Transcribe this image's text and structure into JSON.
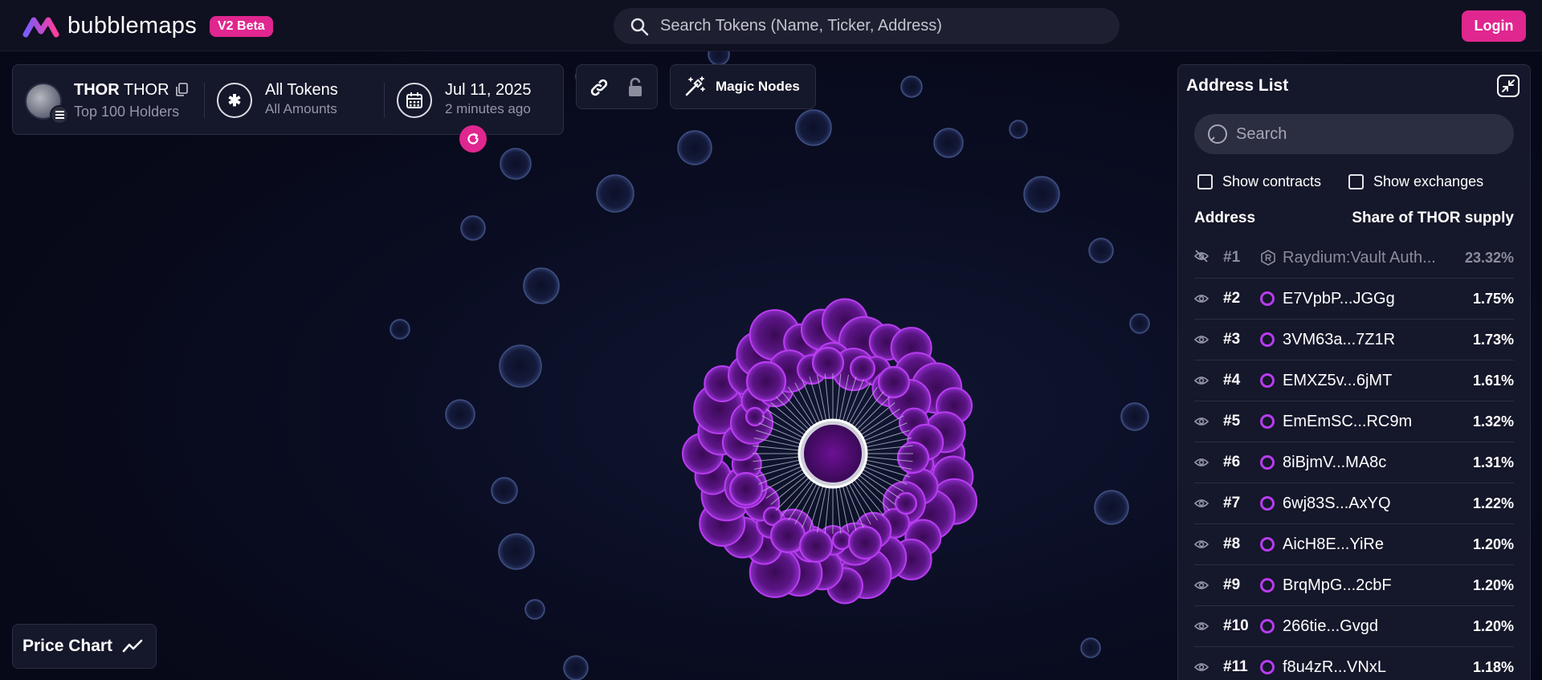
{
  "header": {
    "brand": "bubblemaps",
    "badge": "V2 Beta",
    "search_placeholder": "Search Tokens (Name, Ticker, Address)",
    "login": "Login"
  },
  "token": {
    "name": "THOR",
    "ticker": "THOR",
    "subtitle": "Top 100 Holders",
    "filter_title": "All Tokens",
    "filter_sub": "All Amounts",
    "date": "Jul 11, 2025",
    "date_ago": "2 minutes ago"
  },
  "toolbar": {
    "magic_nodes": "Magic Nodes",
    "price_chart": "Price Chart"
  },
  "address_list": {
    "title": "Address List",
    "search_placeholder": "Search",
    "show_contracts": "Show contracts",
    "show_exchanges": "Show exchanges",
    "col_address": "Address",
    "col_share": "Share of THOR supply",
    "rows": [
      {
        "rank": "#1",
        "address": "Raydium:Vault Auth...",
        "share": "23.32%",
        "hidden": true
      },
      {
        "rank": "#2",
        "address": "E7VpbP...JGGg",
        "share": "1.75%"
      },
      {
        "rank": "#3",
        "address": "3VM63a...7Z1R",
        "share": "1.73%"
      },
      {
        "rank": "#4",
        "address": "EMXZ5v...6jMT",
        "share": "1.61%"
      },
      {
        "rank": "#5",
        "address": "EmEmSC...RC9m",
        "share": "1.32%"
      },
      {
        "rank": "#6",
        "address": "8iBjmV...MA8c",
        "share": "1.31%"
      },
      {
        "rank": "#7",
        "address": "6wj83S...AxYQ",
        "share": "1.22%"
      },
      {
        "rank": "#8",
        "address": "AicH8E...YiRe",
        "share": "1.20%"
      },
      {
        "rank": "#9",
        "address": "BrqMpG...2cbF",
        "share": "1.20%"
      },
      {
        "rank": "#10",
        "address": "266tie...Gvgd",
        "share": "1.20%"
      },
      {
        "rank": "#11",
        "address": "f8u4zR...VNxL",
        "share": "1.18%"
      }
    ]
  },
  "colors": {
    "accent": "#e0268f",
    "bubble_purple": "#b83cf0",
    "bubble_blue": "#3a4a78"
  }
}
